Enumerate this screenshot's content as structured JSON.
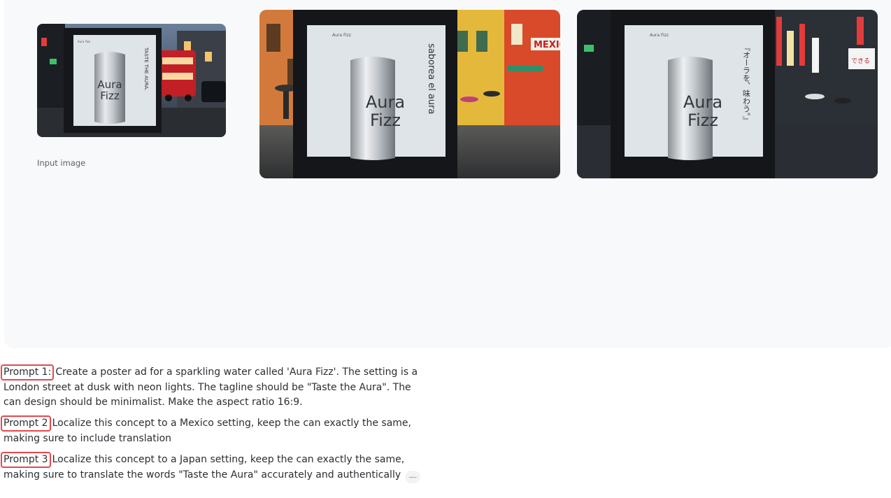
{
  "gallery": {
    "input_caption": "Input image",
    "input_image": {
      "brand_small": "Aura Fizz",
      "brand_line1": "Aura",
      "brand_line2": "Fizz",
      "tagline": "TASTE THE AURA."
    },
    "mexico_image": {
      "brand_small": "Aura Fizz",
      "brand_line1": "Aura",
      "brand_line2": "Fizz",
      "tagline": "saborea el aura",
      "shop_sign": "MEXICA"
    },
    "japan_image": {
      "brand_small": "Aura Fizz",
      "brand_line1": "Aura",
      "brand_line2": "Fizz",
      "tagline": "『オーラを、味わう。』",
      "shop_sign": "できる"
    }
  },
  "prompts": [
    {
      "label": "Prompt 1:",
      "text": "Create a poster ad for a sparkling water called 'Aura Fizz'. The setting is a London street at dusk with neon lights. The tagline should be \"Taste the Aura\". The can design should be minimalist. Make the aspect ratio 16:9."
    },
    {
      "label": "Prompt 2",
      "text": "Localize this concept to a Mexico setting, keep the can exactly the same, making sure to include translation"
    },
    {
      "label": "Prompt 3",
      "text": "Localize this concept to a Japan setting, keep the can exactly the same, making sure to translate the words \"Taste the Aura\" accurately and authentically"
    }
  ],
  "collapse_glyph": "—",
  "colors": {
    "highlight_border": "#e5484d",
    "panel_bg": "#f8f9fa"
  }
}
